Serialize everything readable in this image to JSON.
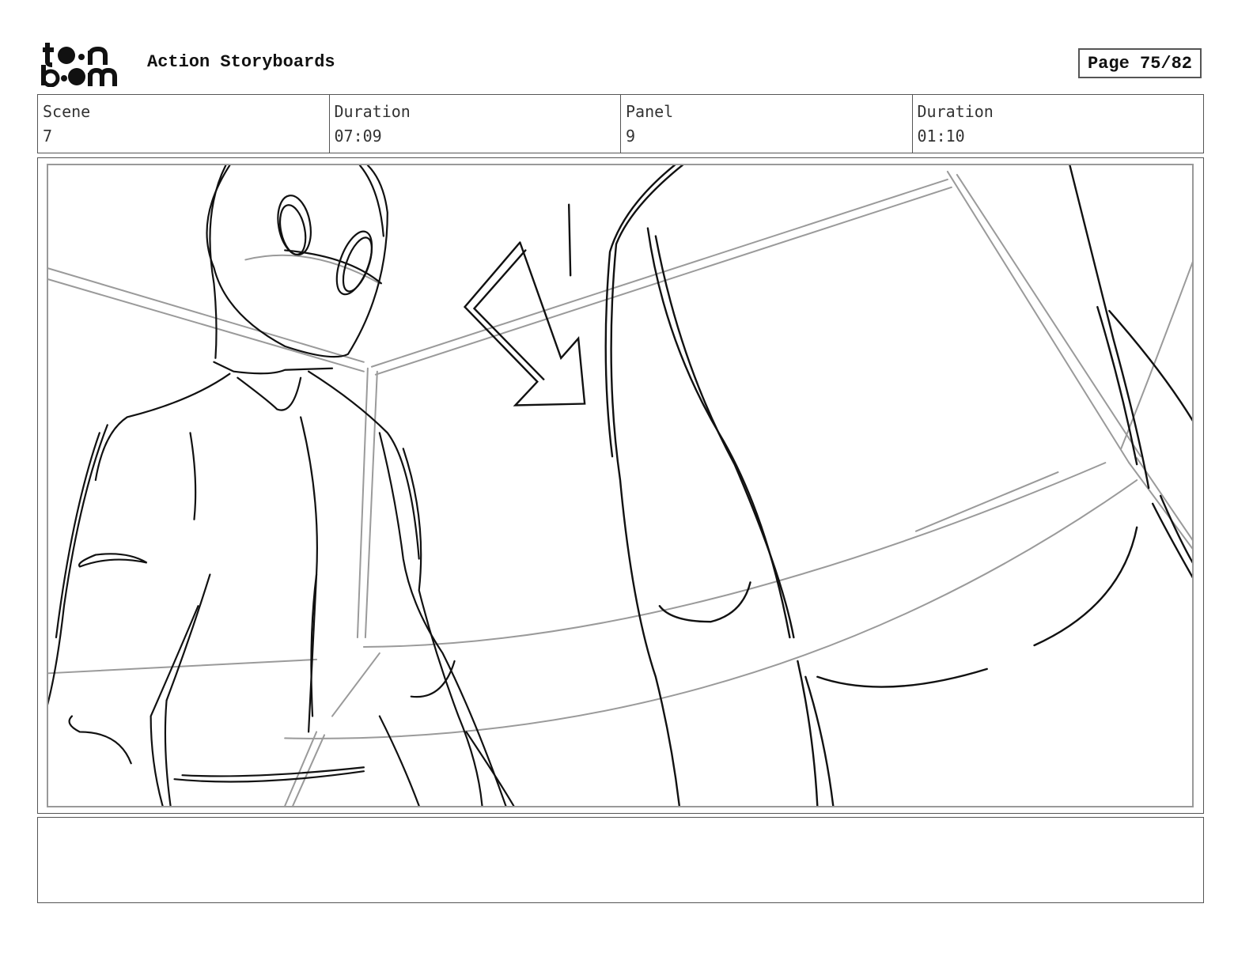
{
  "header": {
    "logo_text_top": "toon",
    "logo_text_bottom": "boom",
    "title": "Action Storyboards",
    "page_label": "Page 75/82"
  },
  "info": [
    {
      "label": "Scene",
      "value": "7"
    },
    {
      "label": "Duration",
      "value": "07:09"
    },
    {
      "label": "Panel",
      "value": "9"
    },
    {
      "label": "Duration",
      "value": "01:10"
    }
  ],
  "panel": {
    "description": ""
  },
  "notes": {
    "text": ""
  },
  "icons": {
    "logo": "toon-boom-logo",
    "arrow": "down-arrow-sketch"
  }
}
